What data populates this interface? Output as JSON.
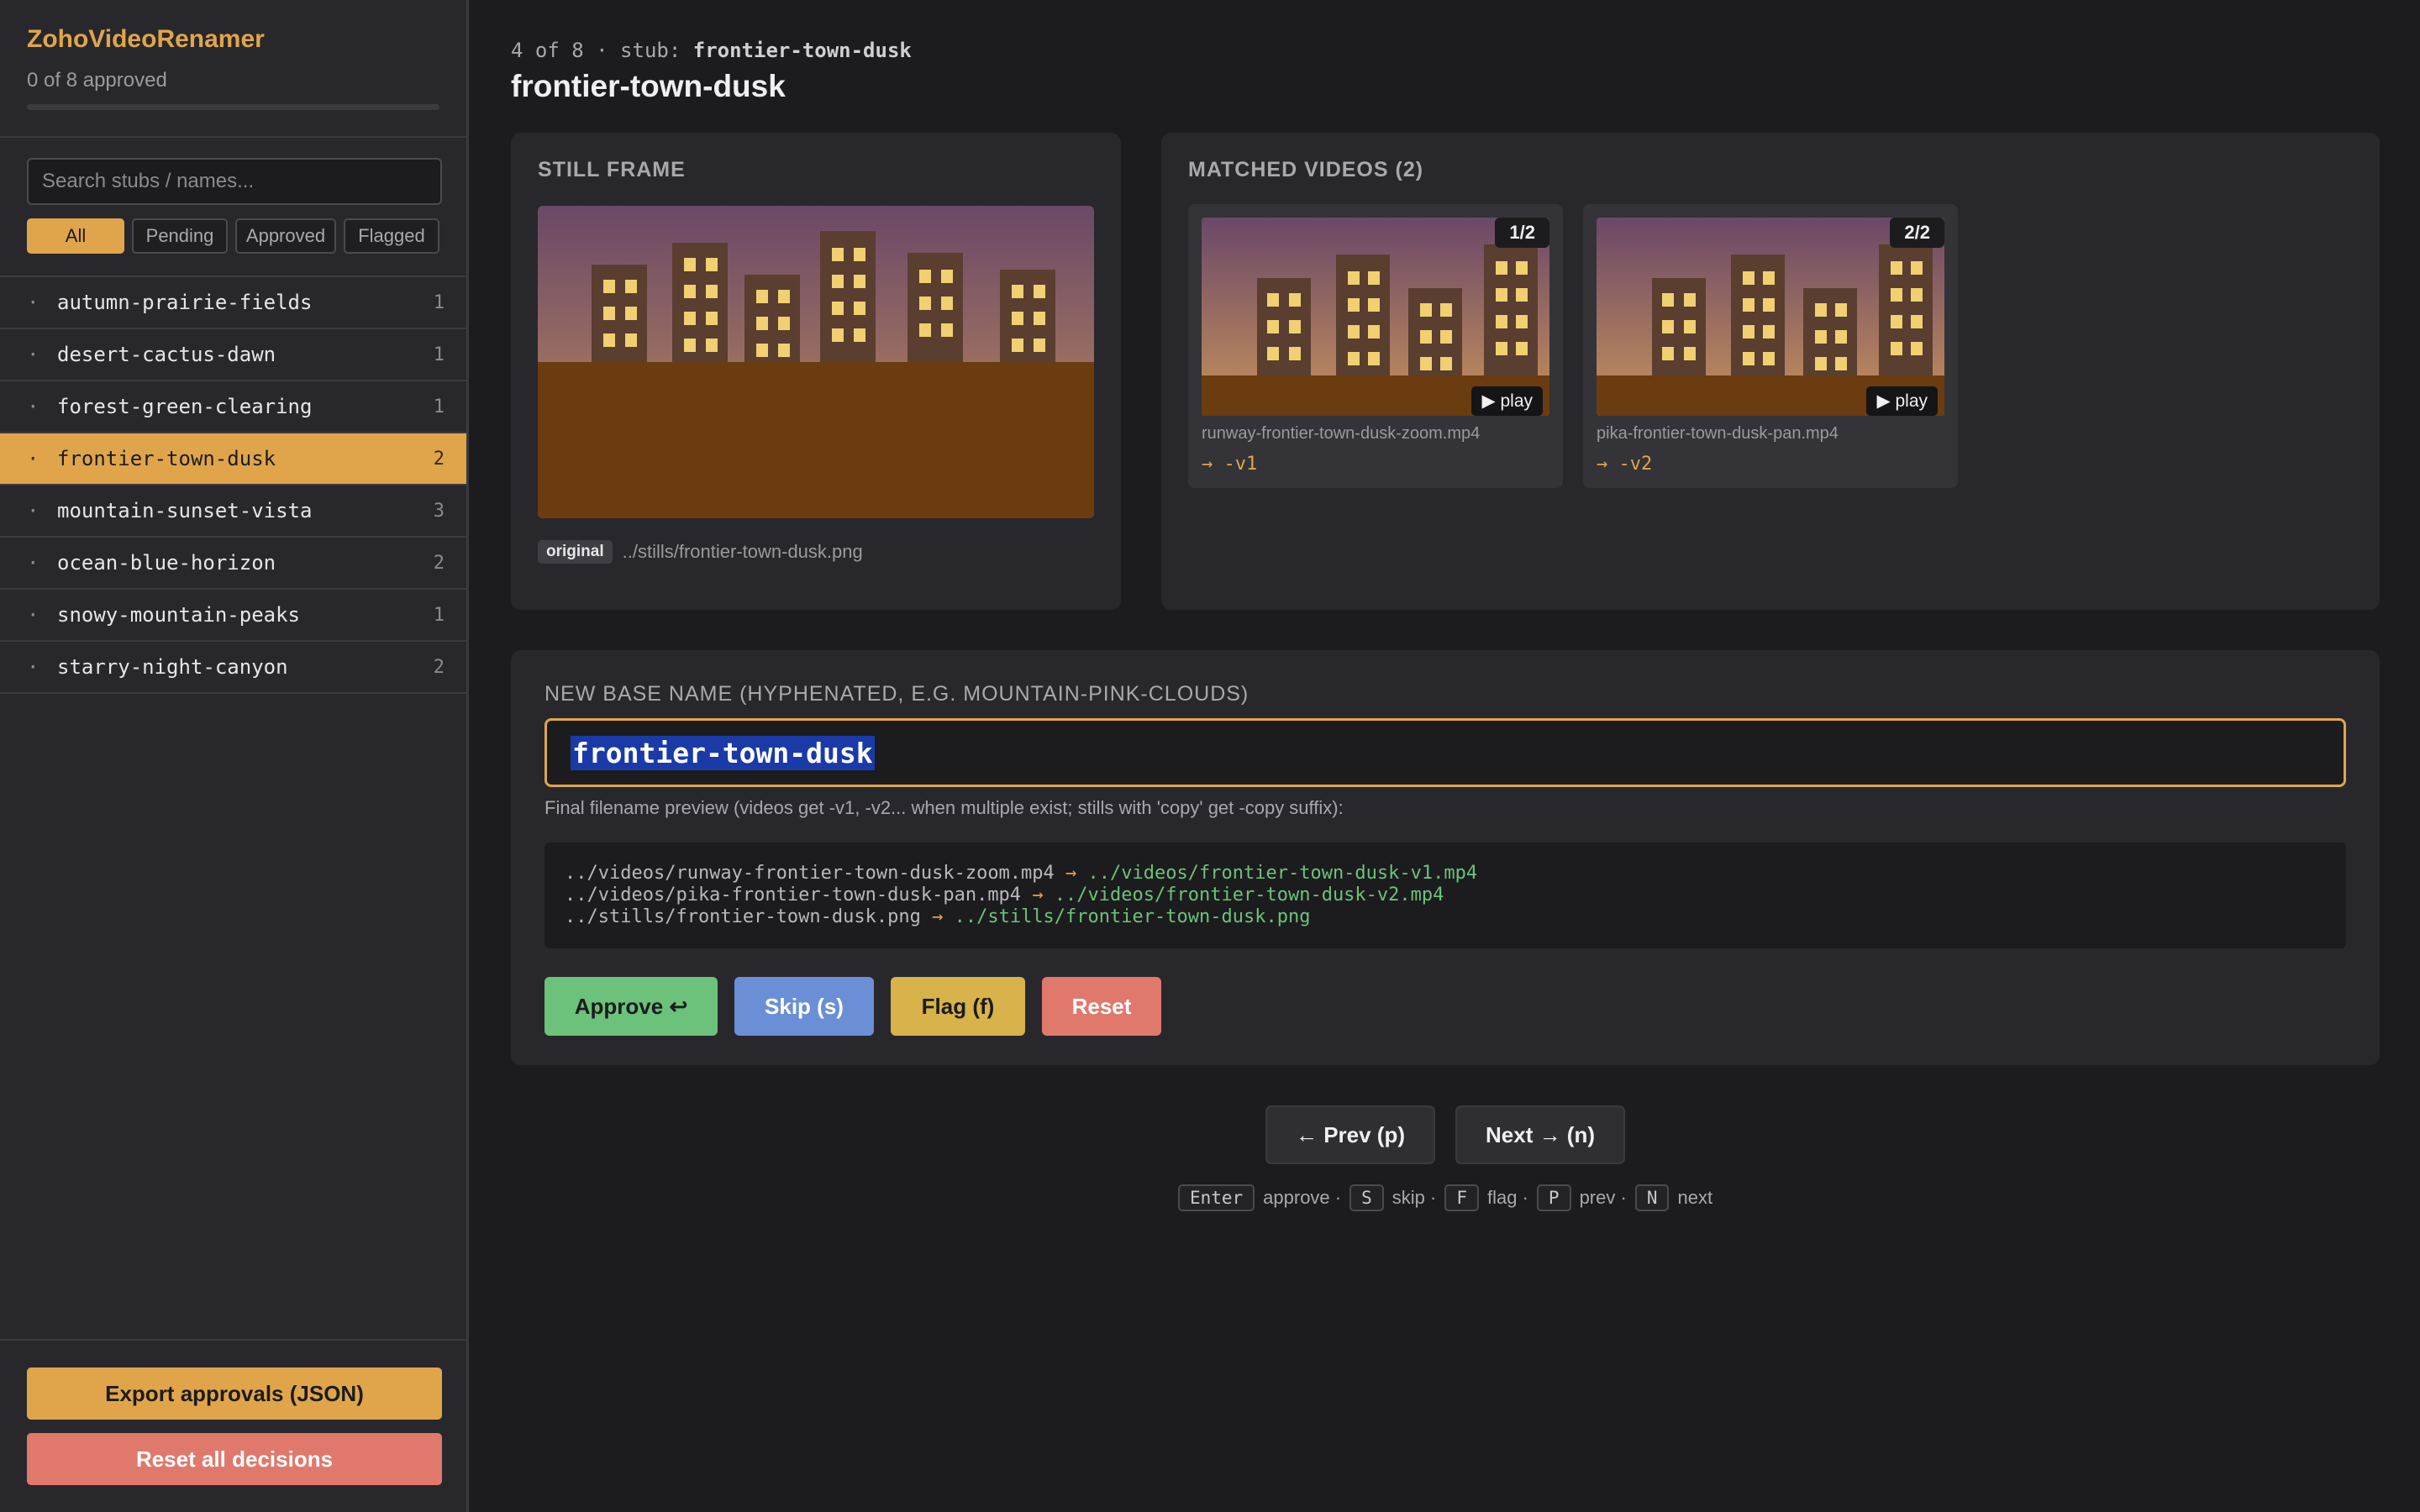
{
  "app": {
    "title": "ZohoVideoRenamer",
    "approved_count": "0 of 8 approved",
    "progress": 0
  },
  "sidebar": {
    "search_placeholder": "Search stubs / names...",
    "filters": [
      "All",
      "Pending",
      "Approved",
      "Flagged"
    ],
    "active_filter": "All",
    "stubs": [
      {
        "name": "autumn-prairie-fields",
        "count": "1"
      },
      {
        "name": "desert-cactus-dawn",
        "count": "1"
      },
      {
        "name": "forest-green-clearing",
        "count": "1"
      },
      {
        "name": "frontier-town-dusk",
        "count": "2",
        "active": true
      },
      {
        "name": "mountain-sunset-vista",
        "count": "3"
      },
      {
        "name": "ocean-blue-horizon",
        "count": "2"
      },
      {
        "name": "snowy-mountain-peaks",
        "count": "1"
      },
      {
        "name": "starry-night-canyon",
        "count": "2"
      }
    ],
    "export_label": "Export approvals (JSON)",
    "reset_all_label": "Reset all decisions"
  },
  "main": {
    "crumb_prefix": "4 of 8 · stub: ",
    "crumb_stub": "frontier-town-dusk",
    "title": "frontier-town-dusk",
    "still": {
      "label": "STILL FRAME",
      "badge": "original",
      "path": "../stills/frontier-town-dusk.png"
    },
    "videos": {
      "label": "MATCHED VIDEOS (2)",
      "play_label": "▶ play",
      "items": [
        {
          "index": "1/2",
          "file": "runway-frontier-town-dusk-zoom.mp4",
          "suffix": "→ -v1"
        },
        {
          "index": "2/2",
          "file": "pika-frontier-town-dusk-pan.mp4",
          "suffix": "→ -v2"
        }
      ]
    },
    "rename": {
      "label": "NEW BASE NAME (HYPHENATED, E.G. MOUNTAIN-PINK-CLOUDS)",
      "value": "frontier-town-dusk",
      "hint": "Final filename preview (videos get -v1, -v2... when multiple exist; stills with 'copy' get -copy suffix):",
      "preview": [
        {
          "src": "../videos/runway-frontier-town-dusk-zoom.mp4",
          "arrow": "→",
          "dst": "../videos/frontier-town-dusk-v1.mp4"
        },
        {
          "src": "../videos/pika-frontier-town-dusk-pan.mp4",
          "arrow": "→",
          "dst": "../videos/frontier-town-dusk-v2.mp4"
        },
        {
          "src": "../stills/frontier-town-dusk.png",
          "arrow": "→",
          "dst": "../stills/frontier-town-dusk.png"
        }
      ]
    },
    "actions": {
      "approve": "Approve ↩",
      "skip": "Skip (s)",
      "flag": "Flag (f)",
      "reset": "Reset"
    },
    "nav": {
      "prev": "← Prev (p)",
      "next": "Next → (n)"
    },
    "shortcuts": [
      {
        "key": "Enter",
        "label": "approve ·"
      },
      {
        "key": "S",
        "label": "skip ·"
      },
      {
        "key": "F",
        "label": "flag ·"
      },
      {
        "key": "P",
        "label": "prev ·"
      },
      {
        "key": "N",
        "label": "next"
      }
    ]
  },
  "colors": {
    "accent": "#e0a54b",
    "approve": "#6cc27a",
    "skip": "#6b8fd6",
    "flag": "#d8b24a",
    "reset": "#e0786c"
  }
}
